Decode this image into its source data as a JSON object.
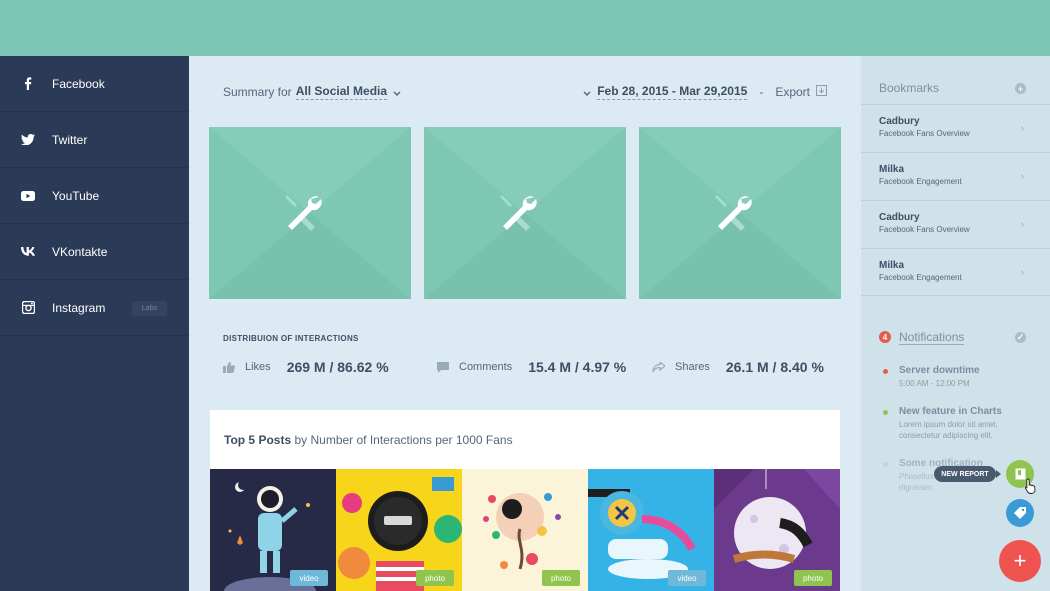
{
  "sidebar": {
    "items": [
      {
        "label": "Facebook",
        "icon": "facebook-icon"
      },
      {
        "label": "Twitter",
        "icon": "twitter-icon"
      },
      {
        "label": "YouTube",
        "icon": "youtube-icon"
      },
      {
        "label": "VKontakte",
        "icon": "vk-icon"
      },
      {
        "label": "Instagram",
        "icon": "instagram-icon",
        "badge": "Labs"
      }
    ]
  },
  "header": {
    "summary_label": "Summary for",
    "summary_value": "All Social Media",
    "date_range": "Feb 28, 2015 - Mar 29,2015",
    "separator": "-",
    "export_label": "Export"
  },
  "distribution": {
    "title": "DISTRIBUION OF INTERACTIONS",
    "stats": [
      {
        "label": "Likes",
        "value": "269 M / 86.62 %",
        "icon": "thumbs-up-icon"
      },
      {
        "label": "Comments",
        "value": "15.4 M / 4.97 %",
        "icon": "comment-icon"
      },
      {
        "label": "Shares",
        "value": "26.1 M / 8.40 %",
        "icon": "share-icon"
      }
    ]
  },
  "posts": {
    "title_bold": "Top 5 Posts",
    "title_rest": "by Number of Interactions per 1000 Fans",
    "items": [
      {
        "badge": "video"
      },
      {
        "badge": "photo"
      },
      {
        "badge": "photo"
      },
      {
        "badge": "video"
      },
      {
        "badge": "photo"
      }
    ]
  },
  "bookmarks": {
    "title": "Bookmarks",
    "items": [
      {
        "name": "Cadbury",
        "desc": "Facebook Fans Overview"
      },
      {
        "name": "Milka",
        "desc": "Facebook Engagement"
      },
      {
        "name": "Cadbury",
        "desc": "Facebook Fans Overview"
      },
      {
        "name": "Milka",
        "desc": "Facebook Engagement"
      }
    ]
  },
  "notifications": {
    "title": "Notifications",
    "count": "4",
    "items": [
      {
        "title": "Server downtime",
        "text": "5:00 AM - 12:00 PM",
        "color": "#e85a4f"
      },
      {
        "title": "New feature in Charts",
        "text": "Lorem ipsum dolor sit amet, consectetur adipiscing elit.",
        "color": "#8fc44e"
      },
      {
        "title": "Some notification",
        "text": "Phasellus ... cursus dignissim.",
        "color": "#b9c7d2"
      }
    ]
  },
  "actions": {
    "new_report_label": "NEW REPORT",
    "add_label": "+"
  },
  "colors": {
    "topbar": "#7cc4b3",
    "sidebar": "#2b3a57",
    "tile": "#85ccb9",
    "accent_red": "#ef5350",
    "accent_green": "#8fc44e",
    "accent_blue": "#3a9bd4"
  }
}
